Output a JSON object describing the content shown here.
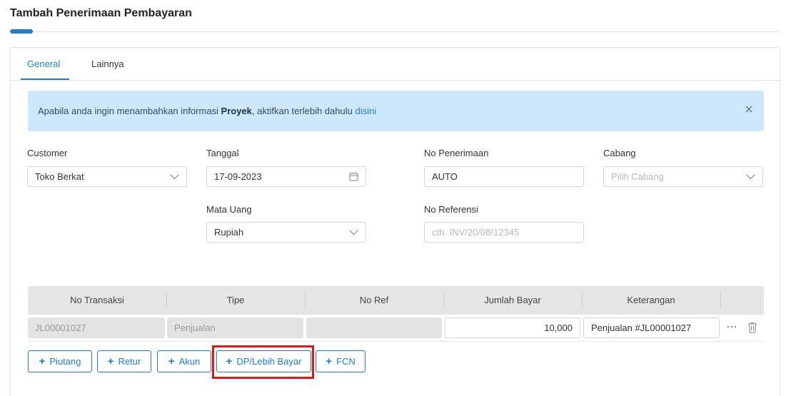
{
  "page": {
    "title": "Tambah Penerimaan Pembayaran"
  },
  "colors": {
    "accent": "#1a7fd4",
    "info_bg": "#cce6fb",
    "highlight": "#e3161c"
  },
  "tabs": [
    {
      "label": "General",
      "active": true
    },
    {
      "label": "Lainnya",
      "active": false
    }
  ],
  "info": {
    "text_before": "Apabila anda ingin menambahkan informasi ",
    "bold": "Proyek",
    "text_after": ", aktifkan terlebih dahulu ",
    "link": "disini",
    "close_icon": "close-icon"
  },
  "form": {
    "customer": {
      "label": "Customer",
      "value": "Toko Berkat",
      "icon": "chevron-down-icon"
    },
    "tanggal": {
      "label": "Tanggal",
      "value": "17-09-2023",
      "icon": "calendar-icon"
    },
    "no_penerimaan": {
      "label": "No Penerimaan",
      "value": "AUTO"
    },
    "cabang": {
      "label": "Cabang",
      "placeholder": "Pilih Cabang",
      "icon": "chevron-down-icon"
    },
    "mata_uang": {
      "label": "Mata Uang",
      "value": "Rupiah",
      "icon": "chevron-down-icon"
    },
    "no_referensi": {
      "label": "No Referensi",
      "placeholder": "cth. INV/20/08/12345"
    }
  },
  "grid": {
    "columns": [
      "No Transaksi",
      "Tipe",
      "No Ref",
      "Jumlah Bayar",
      "Keterangan"
    ],
    "rows": [
      {
        "no_transaksi": "JL00001027",
        "tipe": "Penjualan",
        "no_ref": "",
        "jumlah_bayar": "10,000",
        "keterangan": "Penjualan #JL00001027"
      }
    ]
  },
  "buttons": {
    "piutang": "Piutang",
    "retur": "Retur",
    "akun": "Akun",
    "dp_lebih_bayar": "DP/Lebih Bayar",
    "fcn": "FCN",
    "plus": "+"
  }
}
